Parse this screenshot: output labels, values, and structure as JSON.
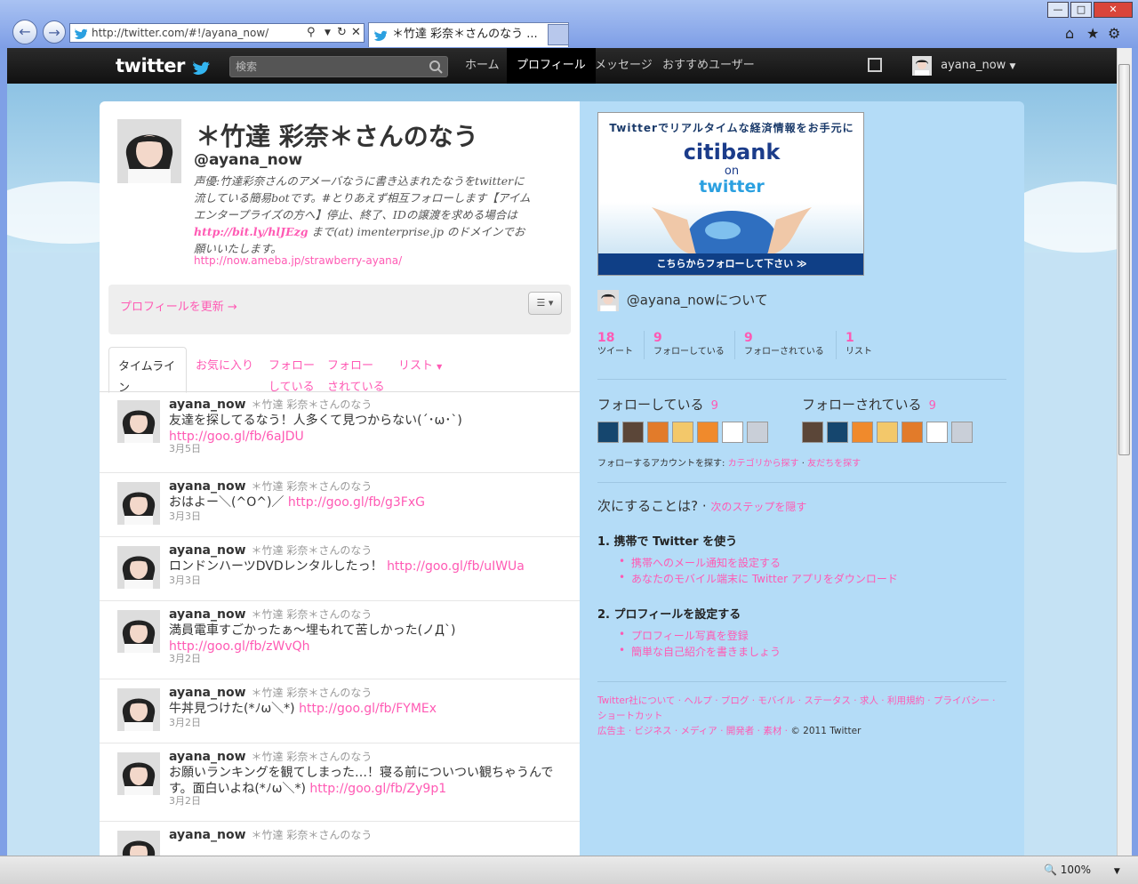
{
  "browser": {
    "url": "http://twitter.com/#!/ayana_now/",
    "tab_title": "＊竹達 彩奈＊さんのなう ...",
    "zoom": "100%"
  },
  "topbar": {
    "logo": "twitter",
    "search_placeholder": "検索",
    "nav": [
      "ホーム",
      "プロフィール",
      "メッセージ",
      "おすすめユーザー"
    ],
    "user": "ayana_now"
  },
  "profile": {
    "name": "＊竹達 彩奈＊さんのなう",
    "handle": "@ayana_now",
    "bio_1": "声優:竹達彩奈さんのアメーバなうに書き込まれたなうをtwitterに流している簡易botです。#とりあえず相互フォローします【アイムエンタープライズの方へ】停止、終了、IDの譲渡を求める場合は ",
    "bio_link": "http://bit.ly/hlJEzg",
    "bio_2": " まで(at) imenterprise.jp のドメインでお願いいたします。",
    "url": "http://now.ameba.jp/strawberry-ayana/",
    "edit": "プロフィールを更新 →"
  },
  "tabs": {
    "timeline": "タイムライン",
    "favorites": "お気に入り",
    "following_1": "フォロー",
    "following_2": "している",
    "followers_1": "フォロー",
    "followers_2": "されている",
    "lists": "リスト"
  },
  "tweets": [
    {
      "user": "ayana_now",
      "real": "＊竹達 彩奈＊さんのなう",
      "text": "友達を探してるなう！人多くて見つからない(´･ω･`) ",
      "link": "http://goo.gl/fb/6aJDU",
      "date": "3月5日"
    },
    {
      "user": "ayana_now",
      "real": "＊竹達 彩奈＊さんのなう",
      "text": "おはよー＼(^O^)／ ",
      "link": "http://goo.gl/fb/g3FxG",
      "date": "3月3日"
    },
    {
      "user": "ayana_now",
      "real": "＊竹達 彩奈＊さんのなう",
      "text": "ロンドンハーツDVDレンタルしたっ！ ",
      "link": "http://goo.gl/fb/uIWUa",
      "date": "3月3日"
    },
    {
      "user": "ayana_now",
      "real": "＊竹達 彩奈＊さんのなう",
      "text": "満員電車すごかったぁ～埋もれて苦しかった(ノД`) ",
      "link": "http://goo.gl/fb/zWvQh",
      "date": "3月2日"
    },
    {
      "user": "ayana_now",
      "real": "＊竹達 彩奈＊さんのなう",
      "text": "牛丼見つけた(*ﾉω＼*) ",
      "link": "http://goo.gl/fb/FYMEx",
      "date": "3月2日"
    },
    {
      "user": "ayana_now",
      "real": "＊竹達 彩奈＊さんのなう",
      "text": "お願いランキングを観てしまった…！寝る前についつい観ちゃうんです。面白いよね(*ﾉω＼*) ",
      "link": "http://goo.gl/fb/Zy9p1",
      "date": "3月2日"
    },
    {
      "user": "ayana_now",
      "real": "＊竹達 彩奈＊さんのなう",
      "text": "",
      "link": "",
      "date": ""
    }
  ],
  "ad": {
    "top": "Twitterでリアルタイムな経済情報をお手元に",
    "citi": "citi",
    "bank": "bank",
    "on": "on",
    "twitter": "twitter",
    "footer": "こちらからフォローして下さい ≫"
  },
  "about": "@ayana_nowについて",
  "stats": [
    {
      "n": "18",
      "label": "ツイート"
    },
    {
      "n": "9",
      "label": "フォローしている"
    },
    {
      "n": "9",
      "label": "フォローされている"
    },
    {
      "n": "1",
      "label": "リスト"
    }
  ],
  "following": {
    "label": "フォローしている",
    "count": "9"
  },
  "followers": {
    "label": "フォローされている",
    "count": "9"
  },
  "find": {
    "label": "フォローするアカウントを探す: ",
    "cat": "カテゴリから探す",
    "sep": " · ",
    "friends": "友だちを探す"
  },
  "next": {
    "title": "次にすることは? · ",
    "hide": "次のステップを隠す"
  },
  "steps": [
    {
      "title": "1.  携帯で Twitter を使う",
      "items": [
        "携帯へのメール通知を設定する",
        "あなたのモバイル端末に Twitter アプリをダウンロード"
      ]
    },
    {
      "title": "2.  プロフィールを設定する",
      "items": [
        "プロフィール写真を登録",
        "簡単な自己紹介を書きましょう"
      ]
    }
  ],
  "footer": {
    "line1": "Twitter社について · ヘルプ · ブログ · モバイル · ステータス · 求人 · 利用規約 · プライバシー · ショートカット",
    "line2": "広告主 · ビジネス · メディア · 開発者 · 素材 · ",
    "copy": "© 2011 Twitter"
  },
  "colors": {
    "link": "#ff5ab4",
    "sidebar": "#b4dcf7",
    "topbar": "#1a1a1a"
  }
}
